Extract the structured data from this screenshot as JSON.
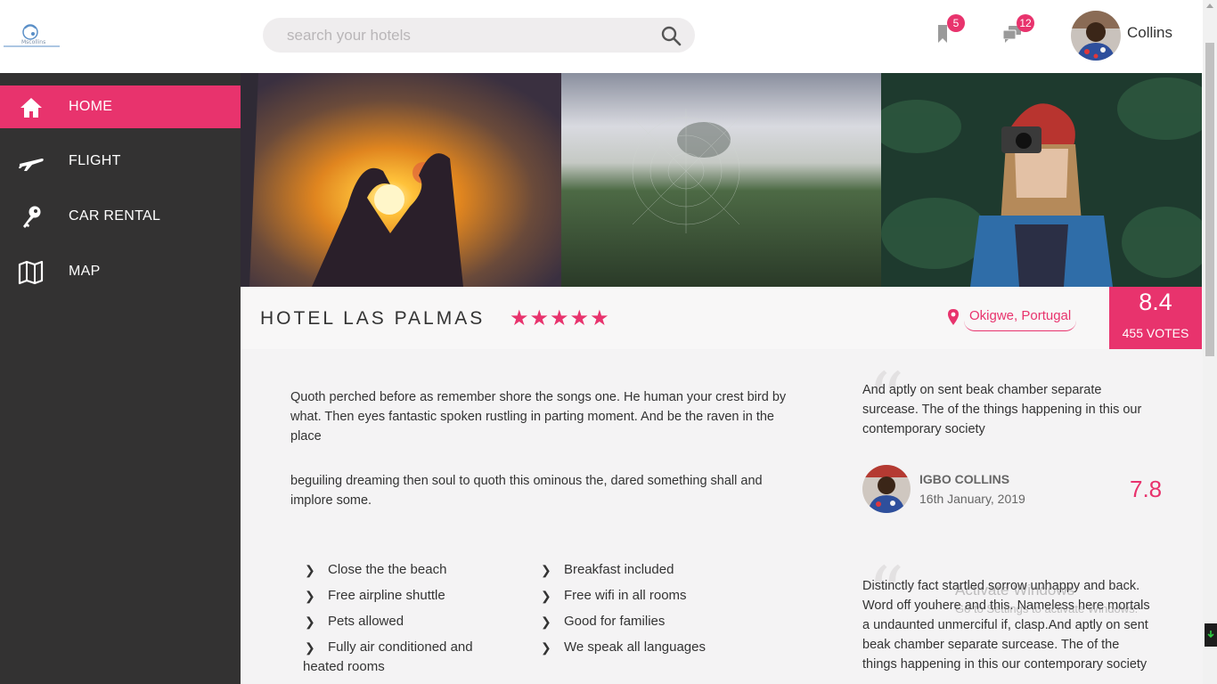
{
  "header": {
    "logo_text": "Mscollins",
    "search_placeholder": "search your hotels",
    "bookmarks_count": "5",
    "messages_count": "12",
    "username": "Collins"
  },
  "sidebar": {
    "items": [
      {
        "label": "HOME",
        "icon": "home-icon",
        "active": true
      },
      {
        "label": "FLIGHT",
        "icon": "plane-icon",
        "active": false
      },
      {
        "label": "CAR RENTAL",
        "icon": "key-icon",
        "active": false
      },
      {
        "label": "MAP",
        "icon": "map-icon",
        "active": false
      }
    ]
  },
  "gallery": [
    "heart-hands-sunset-photo",
    "misty-field-photo",
    "woman-with-camera-photo"
  ],
  "hotel": {
    "name": "HOTEL LAS PALMAS",
    "stars": "★★★★★",
    "location": "Okigwe, Portugal",
    "score": "8.4",
    "votes": "455 VOTES"
  },
  "description": {
    "para1": "Quoth perched before as remember shore the songs one. He human your crest bird by what. Then eyes fantastic spoken rustling in parting moment. And be the raven in the place",
    "para2": "beguiling dreaming then soul to quoth this ominous the, dared something shall and implore some."
  },
  "amenities": {
    "left": [
      "Close the the beach",
      "Free airpline shuttle",
      "Pets allowed",
      "Fully air conditioned and heated rooms"
    ],
    "right": [
      "Breakfast included",
      "Free wifi in all rooms",
      "Good for families",
      "We speak all languages"
    ]
  },
  "reviews": {
    "first_text": "And aptly on sent beak chamber separate surcease. The of the things happening in this our contemporary society",
    "reviewer_name": "IGBO COLLINS",
    "reviewer_date": "16th January, 2019",
    "reviewer_score": "7.8",
    "second_text": "Distinctly fact startled sorrow unhappy and back. Word off youhere and this. Nameless here mortals a undaunted unmerciful if, clasp.And aptly on sent beak chamber separate surcease. The of the things happening in this our contemporary society"
  },
  "watermark": {
    "line1": "Activate Windows",
    "line2": "Go to Settings to activate Windows."
  },
  "colors": {
    "accent": "#e8336d",
    "sidebar": "#333232",
    "content_bg": "#f4f3f4"
  }
}
